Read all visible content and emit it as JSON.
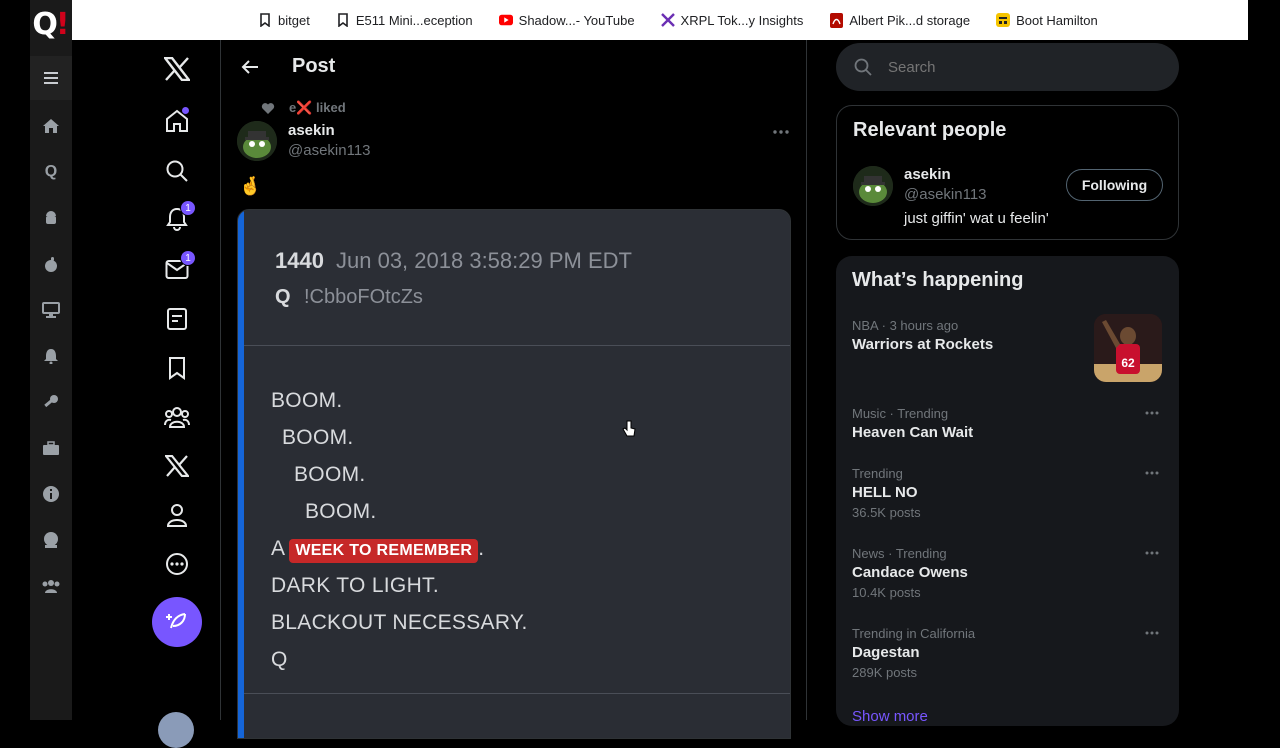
{
  "app": {
    "logo_text": "Q",
    "logo_mark": "!"
  },
  "bookmarks": [
    {
      "label": "bitget",
      "icon": "bookmark-icon"
    },
    {
      "label": "E511 Mini...eception",
      "icon": "bookmark-icon"
    },
    {
      "label": "Shadow...- YouTube",
      "icon": "youtube-icon"
    },
    {
      "label": "XRPL Tok...y Insights",
      "icon": "xrpl-icon"
    },
    {
      "label": "Albert Pik...d storage",
      "icon": "pdf-icon"
    },
    {
      "label": "Boot Hamilton",
      "icon": "app-icon"
    }
  ],
  "nav": {
    "notifications_count": "1",
    "messages_count": "1"
  },
  "post": {
    "header_title": "Post",
    "liked_by": "e❌ liked",
    "author_name": "asekin",
    "author_handle": "@asekin113",
    "text": "🤞",
    "drop": {
      "number": "1440",
      "date": "Jun 03, 2018 3:58:29 PM EDT",
      "signature": "Q",
      "tripcode": "!CbboFOtcZs",
      "lines": {
        "l1": "BOOM.",
        "l2": "BOOM.",
        "l3": "BOOM.",
        "l4": "BOOM.",
        "l5_prefix": "A",
        "l5_highlight": "WEEK TO REMEMBER",
        "l5_suffix": ".",
        "l6": "DARK TO LIGHT.",
        "l7": "BLACKOUT NECESSARY.",
        "l8": "Q"
      }
    }
  },
  "search": {
    "placeholder": "Search"
  },
  "relevant_people": {
    "title": "Relevant people",
    "name": "asekin",
    "handle": "@asekin113",
    "bio": "just giffin' wat u feelin'",
    "follow_label": "Following"
  },
  "happening": {
    "title": "What’s happening",
    "trends": [
      {
        "meta": "NBA · 3 hours ago",
        "name": "Warriors at Rockets",
        "count": ""
      },
      {
        "meta": "Music · Trending",
        "name": "Heaven Can Wait",
        "count": ""
      },
      {
        "meta": "Trending",
        "name": "HELL NO",
        "count": "36.5K posts"
      },
      {
        "meta": "News · Trending",
        "name": "Candace Owens",
        "count": "10.4K posts"
      },
      {
        "meta": "Trending in California",
        "name": "Dagestan",
        "count": "289K posts"
      }
    ],
    "show_more": "Show more",
    "thumb_jersey": "62"
  },
  "colors": {
    "accent": "#7856ff",
    "drop_accent": "#1565d8",
    "highlight": "#c62828"
  }
}
